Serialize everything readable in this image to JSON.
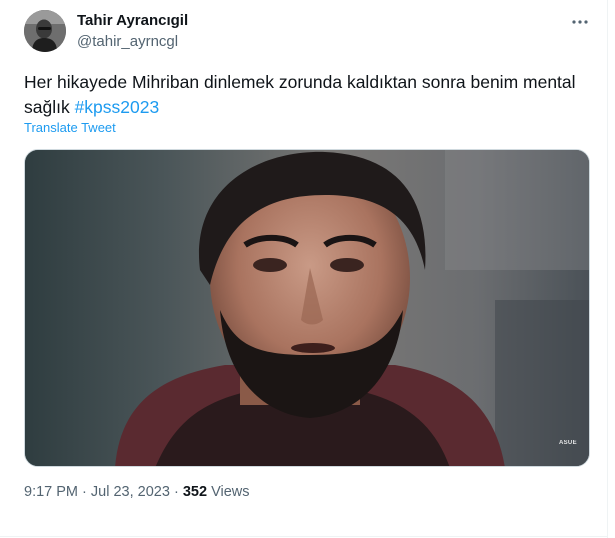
{
  "author": {
    "display_name": "Tahir Ayrancıgil",
    "handle": "@tahir_ayrncgl"
  },
  "tweet": {
    "text": "Her hikayede Mihriban dinlemek zorunda kaldıktan sonra benim mental sağlık ",
    "hashtag": "#kpss2023",
    "translate_label": "Translate Tweet"
  },
  "media": {
    "watermark": "ASUE"
  },
  "meta": {
    "time": "9:17 PM",
    "date": "Jul 23, 2023",
    "separator": "·",
    "views_count": "352",
    "views_label": "Views"
  },
  "icons": {
    "more": "more-dots-icon"
  },
  "colors": {
    "accent": "#1d9bf0",
    "text_primary": "#0f1419",
    "text_secondary": "#536471",
    "border": "#cfd9de"
  }
}
